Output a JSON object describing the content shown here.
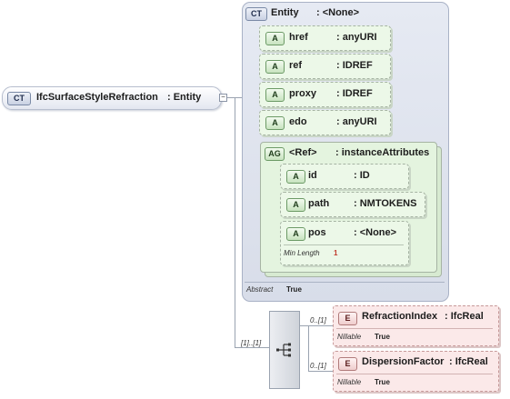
{
  "root": {
    "tag": "CT",
    "name": "IfcSurfaceStyleRefraction",
    "type": ": Entity"
  },
  "entity": {
    "tag": "CT",
    "name": "Entity",
    "type": ": <None>",
    "attributes": [
      {
        "tag": "A",
        "name": "href",
        "type": ": anyURI"
      },
      {
        "tag": "A",
        "name": "ref",
        "type": ": IDREF"
      },
      {
        "tag": "A",
        "name": "proxy",
        "type": ": IDREF"
      },
      {
        "tag": "A",
        "name": "edo",
        "type": ": anyURI"
      }
    ],
    "group": {
      "tag": "AG",
      "name": "<Ref>",
      "type": ": instanceAttributes",
      "attributes": [
        {
          "tag": "A",
          "name": "id",
          "type": ": ID"
        },
        {
          "tag": "A",
          "name": "path",
          "type": ": NMTOKENS"
        },
        {
          "tag": "A",
          "name": "pos",
          "type": ": <None>",
          "facet_label": "Min Length",
          "facet_value": "1"
        }
      ]
    },
    "abstract_label": "Abstract",
    "abstract_value": "True"
  },
  "sequence": {
    "multiplicity": "[1]..[1]"
  },
  "elements": [
    {
      "tag": "E",
      "multiplicity": "0..[1]",
      "name": "RefractionIndex",
      "type": ": IfcReal",
      "nillable_label": "Nillable",
      "nillable_value": "True"
    },
    {
      "tag": "E",
      "multiplicity": "0..[1]",
      "name": "DispersionFactor",
      "type": ": IfcReal",
      "nillable_label": "Nillable",
      "nillable_value": "True"
    }
  ]
}
